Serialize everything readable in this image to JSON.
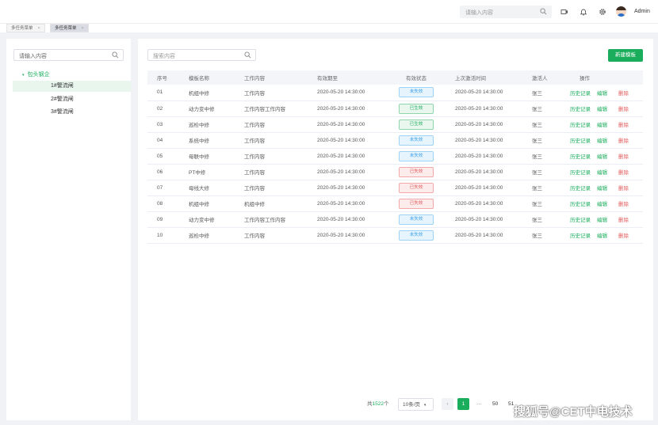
{
  "header": {
    "search_placeholder": "请输入内容",
    "user_name": "Admin",
    "icons": [
      "search-icon",
      "video-icon",
      "bell-icon",
      "gear-icon"
    ]
  },
  "tabs": [
    {
      "label": "多任务菜单",
      "close": "×",
      "active": false
    },
    {
      "label": "多任务菜单",
      "close": "×",
      "active": true
    }
  ],
  "sidebar": {
    "search_placeholder": "请输入内容",
    "root": {
      "caret": "▾",
      "label": "包头钢企"
    },
    "nodes": [
      {
        "label": "1#警流闸",
        "selected": true
      },
      {
        "label": "2#警流闸",
        "selected": false
      },
      {
        "label": "3#警流闸",
        "selected": false
      }
    ]
  },
  "main": {
    "search_placeholder": "搜索内容",
    "new_button": "新建模板",
    "columns": [
      "序号",
      "模板名称",
      "工作内容",
      "有效期至",
      "有效状态",
      "上次激活时间",
      "激活人",
      "操作"
    ],
    "actions": {
      "history": "历史记录",
      "edit": "编辑",
      "delete": "删除"
    },
    "rows": [
      {
        "no": "01",
        "name": "机组中修",
        "content": "工作内容",
        "expire": "2020-05-20 14:30:00",
        "status": "未失效",
        "status_type": "unexpired",
        "last": "2020-05-20 14:30:00",
        "person": "张三"
      },
      {
        "no": "02",
        "name": "动力变中修",
        "content": "工作内容工作内容",
        "expire": "2020-05-20 14:30:00",
        "status": "已生效",
        "status_type": "effective",
        "last": "2020-05-20 14:30:00",
        "person": "张三"
      },
      {
        "no": "03",
        "name": "巡检中修",
        "content": "工作内容",
        "expire": "2020-05-20 14:30:00",
        "status": "已生效",
        "status_type": "effective",
        "last": "2020-05-20 14:30:00",
        "person": "张三"
      },
      {
        "no": "04",
        "name": "系统中修",
        "content": "工作内容",
        "expire": "2020-05-20 14:30:00",
        "status": "未失效",
        "status_type": "unexpired",
        "last": "2020-05-20 14:30:00",
        "person": "张三"
      },
      {
        "no": "05",
        "name": "母联中修",
        "content": "工作内容",
        "expire": "2020-05-20 14:30:00",
        "status": "未失效",
        "status_type": "unexpired",
        "last": "2020-05-20 14:30:00",
        "person": "张三"
      },
      {
        "no": "06",
        "name": "PT中修",
        "content": "工作内容",
        "expire": "2020-05-20 14:30:00",
        "status": "已失效",
        "status_type": "expired",
        "last": "2020-05-20 14:30:00",
        "person": "张三"
      },
      {
        "no": "07",
        "name": "母线大修",
        "content": "工作内容",
        "expire": "2020-05-20 14:30:00",
        "status": "已失效",
        "status_type": "expired",
        "last": "2020-05-20 14:30:00",
        "person": "张三"
      },
      {
        "no": "08",
        "name": "机组中修",
        "content": "机组中修",
        "expire": "2020-05-20 14:30:00",
        "status": "已失效",
        "status_type": "expired",
        "last": "2020-05-20 14:30:00",
        "person": "张三"
      },
      {
        "no": "09",
        "name": "动力变中修",
        "content": "工作内容工作内容",
        "expire": "2020-05-20 14:30:00",
        "status": "未失效",
        "status_type": "unexpired",
        "last": "2020-05-20 14:30:00",
        "person": "张三"
      },
      {
        "no": "10",
        "name": "巡检中修",
        "content": "工作内容",
        "expire": "2020-05-20 14:30:00",
        "status": "未失效",
        "status_type": "unexpired",
        "last": "2020-05-20 14:30:00",
        "person": "张三"
      }
    ]
  },
  "pagination": {
    "total_prefix": "共",
    "total": "1522",
    "total_suffix": "个",
    "page_size": "10条/页",
    "prev": "‹",
    "current": "1",
    "ellipsis": "···",
    "pages": [
      "50",
      "51"
    ]
  },
  "watermark": "搜狐号@CET中电技术",
  "colors": {
    "accent": "#1aad5c",
    "danger": "#e35a5a",
    "info": "#3aa0e4"
  }
}
